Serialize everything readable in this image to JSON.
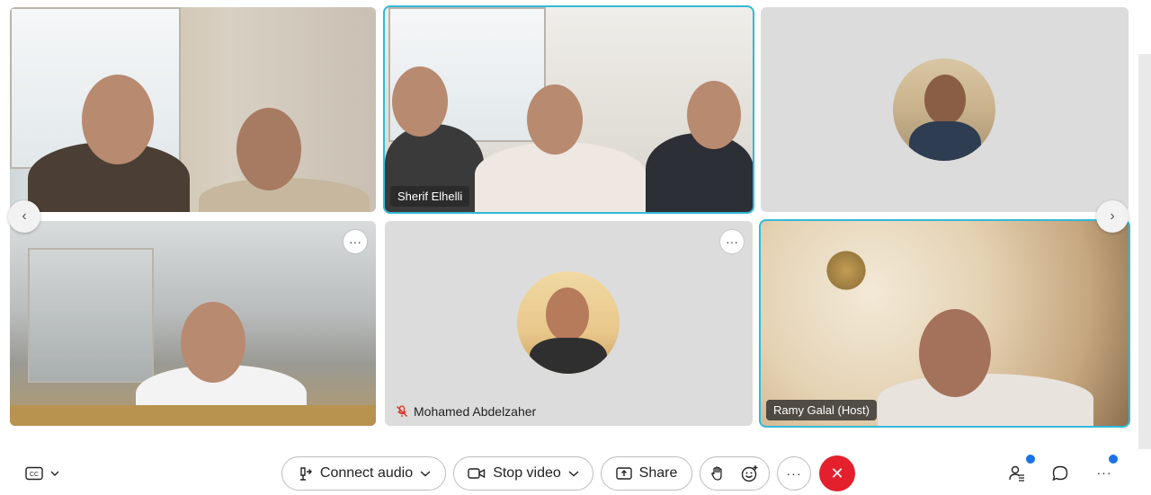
{
  "participants": [
    {
      "id": "p1",
      "name": "",
      "active": false
    },
    {
      "id": "p2",
      "name": "Sherif Elhelli",
      "active": true
    },
    {
      "id": "p3",
      "name": "",
      "active": false
    },
    {
      "id": "p4",
      "name": "",
      "active": false
    },
    {
      "id": "p5",
      "name": "Mohamed Abdelzaher",
      "active": false,
      "muted": true
    },
    {
      "id": "p6",
      "name": "Ramy Galal (Host)",
      "active": true
    }
  ],
  "tile_more_label": "···",
  "nav": {
    "prev": "‹",
    "next": "›"
  },
  "toolbar": {
    "cc_label": "CC",
    "connect_audio": "Connect audio",
    "stop_video": "Stop video",
    "share": "Share",
    "more_label": "···",
    "end_label": "✕",
    "right_more_label": "···"
  },
  "colors": {
    "accent": "#35b8d6",
    "end_call": "#e3202b",
    "notify_dot": "#1a73e8"
  },
  "icons": [
    "cc-icon",
    "chevron-down-icon",
    "connect-audio-icon",
    "video-icon",
    "share-icon",
    "raise-hand-icon",
    "reactions-icon",
    "participants-icon",
    "chat-icon",
    "mic-muted-icon"
  ]
}
